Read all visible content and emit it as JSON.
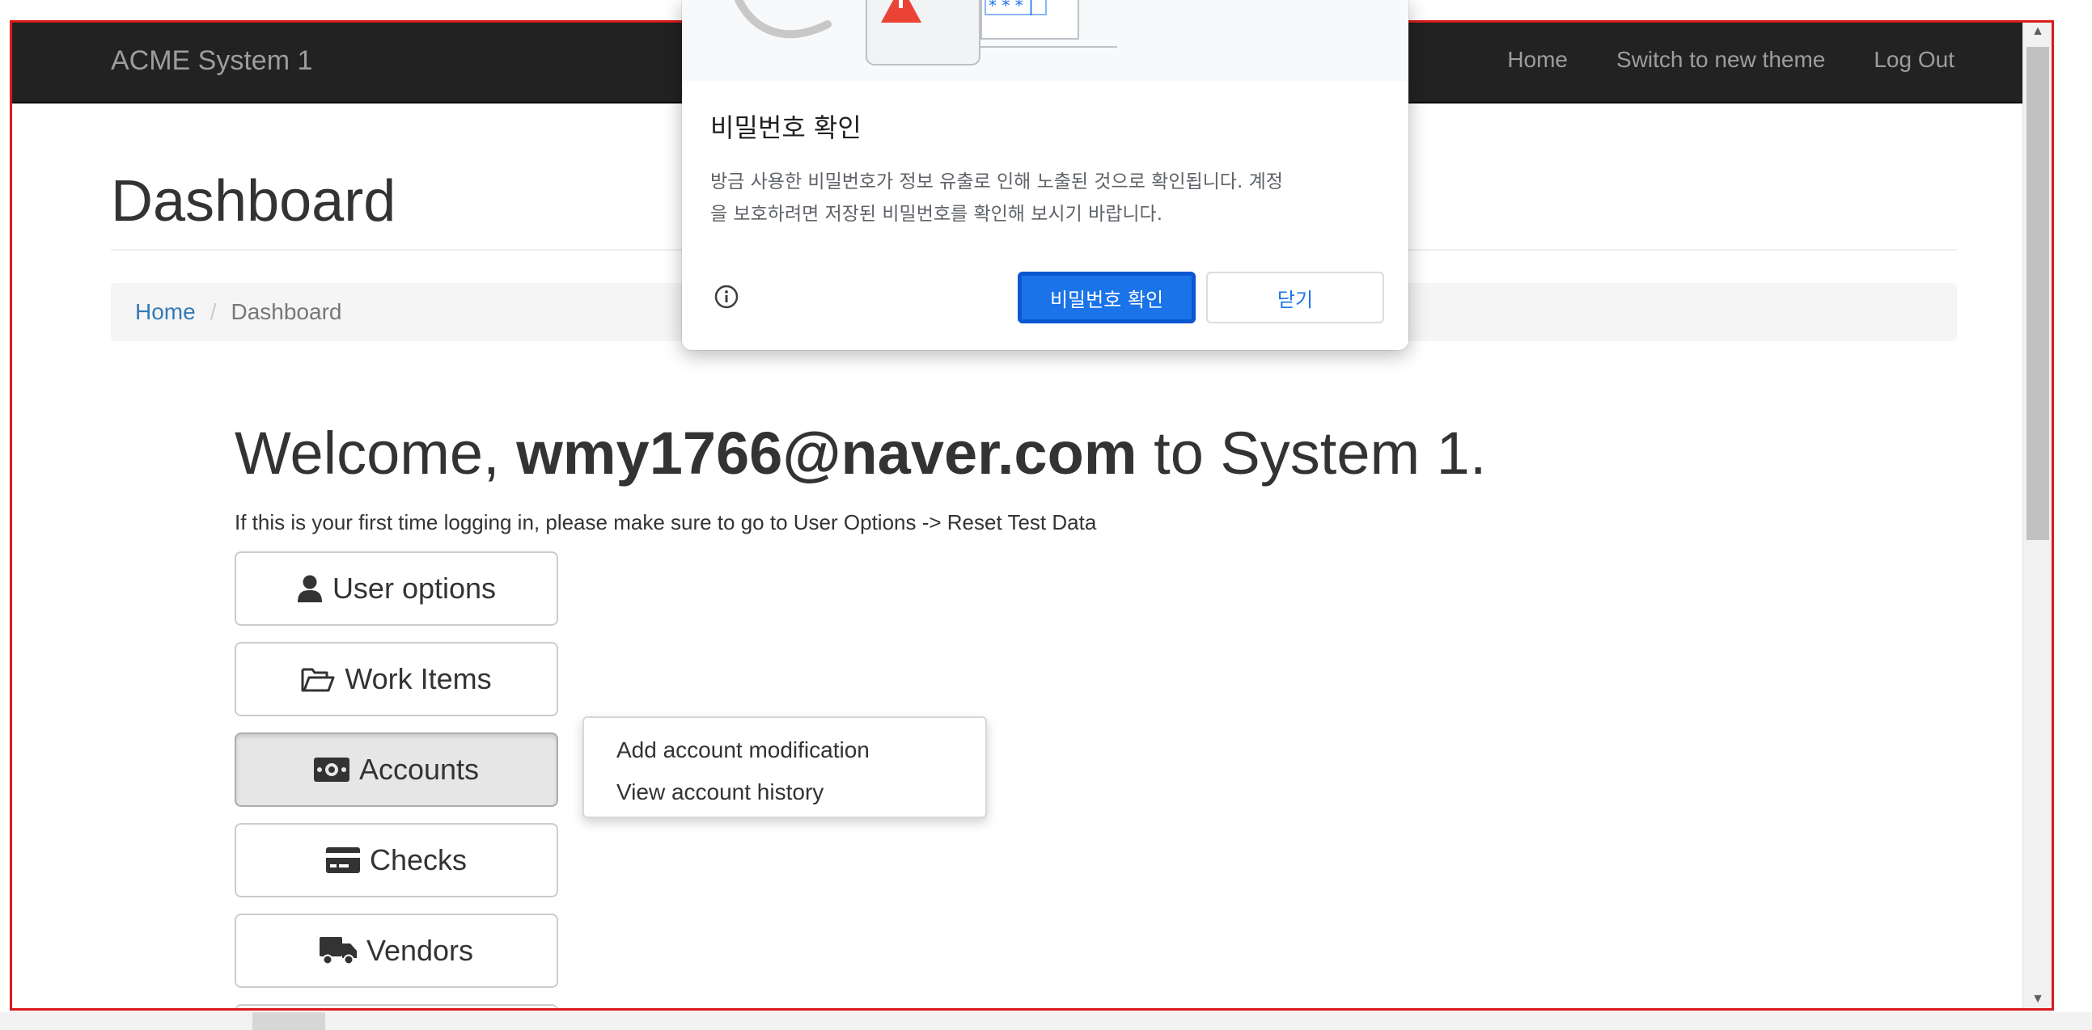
{
  "navbar": {
    "brand": "ACME System 1",
    "links": [
      "Home",
      "Switch to new theme",
      "Log Out"
    ]
  },
  "page": {
    "title": "Dashboard",
    "breadcrumb": {
      "home": "Home",
      "separator": "/",
      "current": "Dashboard"
    }
  },
  "welcome": {
    "prefix": "Welcome, ",
    "user": "wmy1766@naver.com",
    "suffix": " to System 1.",
    "hint": "If this is your first time logging in, please make sure to go to User Options -> Reset Test Data"
  },
  "menu": [
    {
      "label": "User options",
      "icon": "user-icon"
    },
    {
      "label": "Work Items",
      "icon": "folder-open-icon"
    },
    {
      "label": "Accounts",
      "icon": "money-bill-icon",
      "active": true
    },
    {
      "label": "Checks",
      "icon": "credit-card-icon"
    },
    {
      "label": "Vendors",
      "icon": "truck-icon"
    }
  ],
  "accounts_dropdown": [
    "Add account modification",
    "View account history"
  ],
  "password_dialog": {
    "title": "비밀번호 확인",
    "body_line1": "방금 사용한 비밀번호가 정보 유출로 인해 노출된 것으로 확인됩니다. 계정",
    "body_line2": "을 보호하려면 저장된 비밀번호를 확인해 보시기 바랍니다.",
    "confirm_label": "비밀번호 확인",
    "close_label": "닫기",
    "illustration_stars": "* * * |"
  },
  "colors": {
    "navbar_bg": "#222222",
    "link": "#337ab7",
    "dialog_primary": "#1a73e8",
    "warning": "#ea4335",
    "frame_border": "#d81b1b"
  }
}
